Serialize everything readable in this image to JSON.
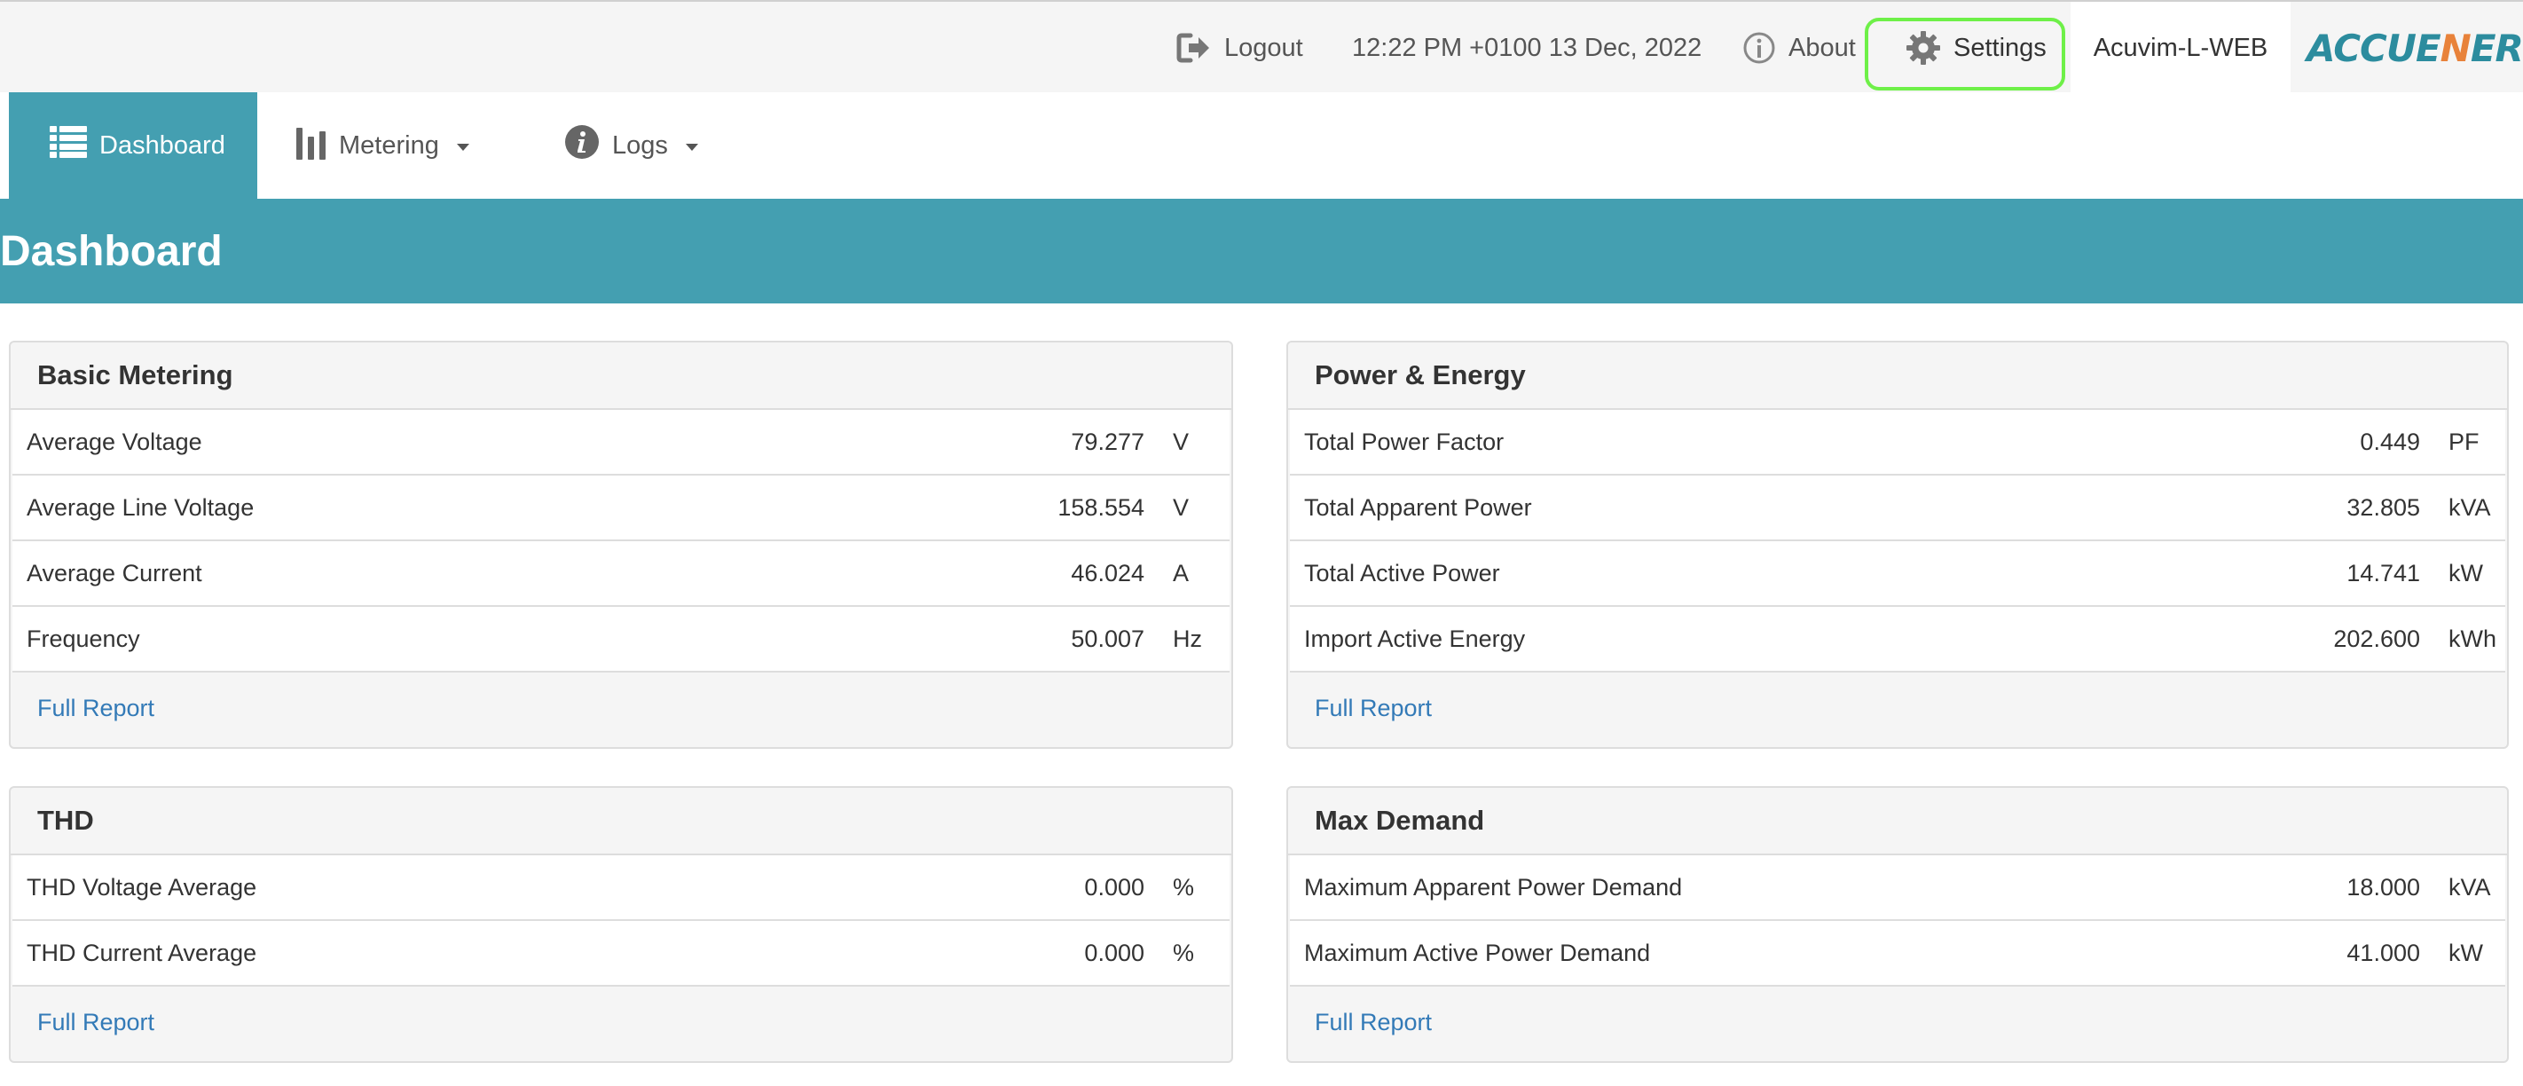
{
  "header": {
    "logout_label": "Logout",
    "datetime": "12:22 PM +0100 13 Dec, 2022",
    "about_label": "About",
    "settings_label": "Settings",
    "device_name": "Acuvim-L-WEB",
    "logo_main": "ACCUE",
    "logo_accent": "N",
    "logo_tail": "ERGY"
  },
  "nav": {
    "dashboard_label": "Dashboard",
    "metering_label": "Metering",
    "logs_label": "Logs"
  },
  "page": {
    "title": "Dashboard"
  },
  "panels": {
    "basic_metering": {
      "title": "Basic Metering",
      "rows": [
        {
          "label": "Average Voltage",
          "value": "79.277",
          "unit": "V"
        },
        {
          "label": "Average Line Voltage",
          "value": "158.554",
          "unit": "V"
        },
        {
          "label": "Average Current",
          "value": "46.024",
          "unit": "A"
        },
        {
          "label": "Frequency",
          "value": "50.007",
          "unit": "Hz"
        }
      ],
      "footer_link": "Full Report"
    },
    "power_energy": {
      "title": "Power & Energy",
      "rows": [
        {
          "label": "Total Power Factor",
          "value": "0.449",
          "unit": "PF"
        },
        {
          "label": "Total Apparent Power",
          "value": "32.805",
          "unit": "kVA"
        },
        {
          "label": "Total Active Power",
          "value": "14.741",
          "unit": "kW"
        },
        {
          "label": "Import Active Energy",
          "value": "202.600",
          "unit": "kWh"
        }
      ],
      "footer_link": "Full Report"
    },
    "thd": {
      "title": "THD",
      "rows": [
        {
          "label": "THD Voltage Average",
          "value": "0.000",
          "unit": "%"
        },
        {
          "label": "THD Current Average",
          "value": "0.000",
          "unit": "%"
        }
      ],
      "footer_link": "Full Report"
    },
    "max_demand": {
      "title": "Max Demand",
      "rows": [
        {
          "label": "Maximum Apparent Power Demand",
          "value": "18.000",
          "unit": "kVA"
        },
        {
          "label": "Maximum Active Power Demand",
          "value": "41.000",
          "unit": "kW"
        }
      ],
      "footer_link": "Full Report"
    }
  },
  "colors": {
    "accent": "#449fb1",
    "highlight": "#6ef048",
    "link": "#337ab7"
  },
  "icons": {
    "logout": "logout-icon",
    "about": "info-circle-icon",
    "settings": "gear-icon",
    "dashboard": "list-icon",
    "metering": "bar-chart-icon",
    "logs": "info-icon"
  }
}
